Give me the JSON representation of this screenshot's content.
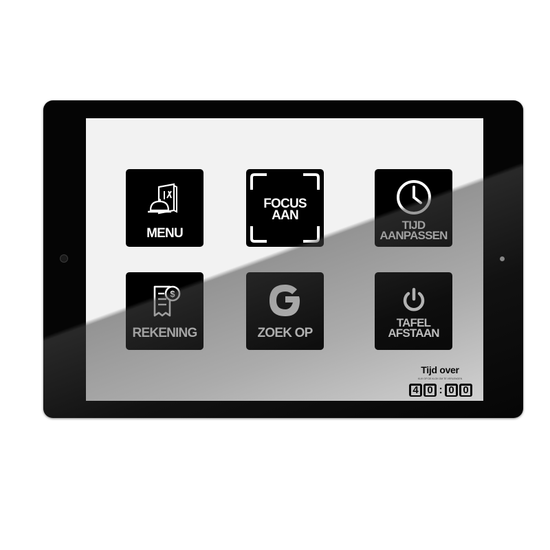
{
  "tiles": {
    "menu": {
      "label": "MENU",
      "icon": "menu-cloche-icon"
    },
    "focus": {
      "line1": "FOCUS",
      "line2": "AAN",
      "icon": "focus-frame-icon"
    },
    "time": {
      "line1": "TIJD",
      "line2": "AANPASSEN",
      "icon": "clock-icon"
    },
    "bill": {
      "label": "REKENING",
      "icon": "bill-dollar-icon"
    },
    "search": {
      "label": "ZOEK OP",
      "icon": "google-g-icon"
    },
    "table": {
      "line1": "TAFEL",
      "line2": "AFSTAAN",
      "icon": "power-icon"
    }
  },
  "timer": {
    "title": "Tijd over",
    "subtitle": "KLIK OP DE KLOK OM TE VERLENGEN",
    "digits": [
      "4",
      "0",
      "0",
      "0"
    ],
    "separator": ":"
  },
  "colors": {
    "screen": "#f2f2f2",
    "tile": "#000000",
    "bezel": "#050505"
  }
}
